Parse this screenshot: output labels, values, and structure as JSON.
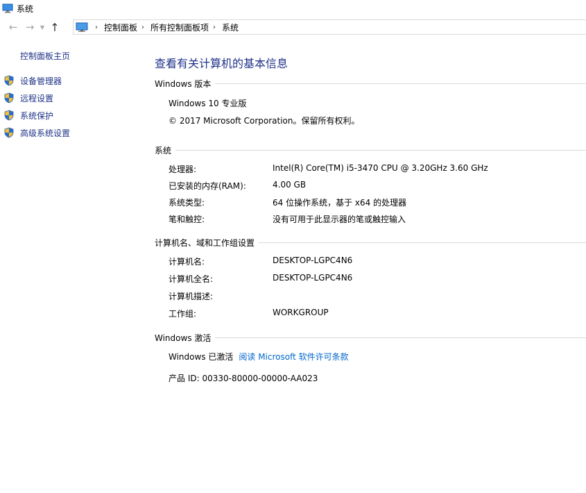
{
  "window": {
    "title": "系统"
  },
  "nav": {
    "back_glyph": "←",
    "forward_glyph": "→",
    "dropdown_glyph": "▼",
    "up_glyph": "↑",
    "separator_glyph": "›",
    "breadcrumbs": [
      "控制面板",
      "所有控制面板项",
      "系统"
    ]
  },
  "sidebar": {
    "home": "控制面板主页",
    "items": [
      {
        "label": "设备管理器",
        "icon": "uac-shield-icon"
      },
      {
        "label": "远程设置",
        "icon": "uac-shield-icon"
      },
      {
        "label": "系统保护",
        "icon": "uac-shield-icon"
      },
      {
        "label": "高级系统设置",
        "icon": "uac-shield-icon"
      }
    ]
  },
  "main": {
    "title": "查看有关计算机的基本信息",
    "edition": {
      "heading": "Windows 版本",
      "name": "Windows 10 专业版",
      "copyright": "© 2017 Microsoft Corporation。保留所有权利。"
    },
    "system": {
      "heading": "系统",
      "rows": [
        {
          "label": "处理器:",
          "value": "Intel(R) Core(TM) i5-3470 CPU @ 3.20GHz   3.60 GHz"
        },
        {
          "label": "已安装的内存(RAM):",
          "value": "4.00 GB"
        },
        {
          "label": "系统类型:",
          "value": "64 位操作系统，基于 x64 的处理器"
        },
        {
          "label": "笔和触控:",
          "value": "没有可用于此显示器的笔或触控输入"
        }
      ]
    },
    "computer": {
      "heading": "计算机名、域和工作组设置",
      "rows": [
        {
          "label": "计算机名:",
          "value": "DESKTOP-LGPC4N6"
        },
        {
          "label": "计算机全名:",
          "value": "DESKTOP-LGPC4N6"
        },
        {
          "label": "计算机描述:",
          "value": ""
        },
        {
          "label": "工作组:",
          "value": "WORKGROUP"
        }
      ]
    },
    "activation": {
      "heading": "Windows 激活",
      "status": "Windows 已激活",
      "link": "阅读 Microsoft 软件许可条款",
      "product_id": "产品 ID: 00330-80000-00000-AA023"
    }
  },
  "colors": {
    "link": "#0066cc",
    "nav_link": "#1e3287",
    "divider": "#dadada"
  }
}
